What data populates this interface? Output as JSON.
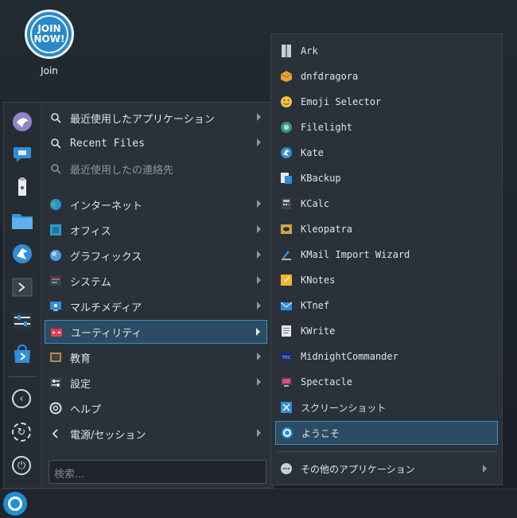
{
  "desktop": {
    "icon_label": "Join",
    "logo_line1": "JOIN",
    "logo_line2": "NOW!"
  },
  "menu": {
    "categories": [
      {
        "label": "最近使用したアプリケーション",
        "icon": "search-icon"
      },
      {
        "label": "Recent Files",
        "icon": "search-icon"
      },
      {
        "label": "最近使用したの連絡先",
        "icon": "search-icon"
      },
      {
        "label": "インターネット",
        "icon": "globe-icon"
      },
      {
        "label": "オフィス",
        "icon": "office-icon"
      },
      {
        "label": "グラフィックス",
        "icon": "graphics-icon"
      },
      {
        "label": "システム",
        "icon": "system-icon"
      },
      {
        "label": "マルチメディア",
        "icon": "multimedia-icon"
      },
      {
        "label": "ユーティリティ",
        "icon": "utilities-icon"
      },
      {
        "label": "教育",
        "icon": "education-icon"
      },
      {
        "label": "設定",
        "icon": "settings-icon"
      },
      {
        "label": "ヘルプ",
        "icon": "help-icon"
      },
      {
        "label": "電源/セッション",
        "icon": "chevron-left-icon"
      }
    ],
    "selected_category": "ユーティリティ",
    "search_placeholder": "検索..."
  },
  "submenu": {
    "apps": [
      {
        "label": "Ark",
        "icon": "ark-icon"
      },
      {
        "label": "dnfdragora",
        "icon": "dnfdragora-icon"
      },
      {
        "label": "Emoji Selector",
        "icon": "emoji-icon"
      },
      {
        "label": "Filelight",
        "icon": "filelight-icon"
      },
      {
        "label": "Kate",
        "icon": "kate-icon"
      },
      {
        "label": "KBackup",
        "icon": "kbackup-icon"
      },
      {
        "label": "KCalc",
        "icon": "kcalc-icon"
      },
      {
        "label": "Kleopatra",
        "icon": "kleopatra-icon"
      },
      {
        "label": "KMail Import Wizard",
        "icon": "kmail-icon"
      },
      {
        "label": "KNotes",
        "icon": "knotes-icon"
      },
      {
        "label": "KTnef",
        "icon": "ktnef-icon"
      },
      {
        "label": "KWrite",
        "icon": "kwrite-icon"
      },
      {
        "label": "MidnightCommander",
        "icon": "mc-icon"
      },
      {
        "label": "Spectacle",
        "icon": "spectacle-icon"
      },
      {
        "label": "スクリーンショット",
        "icon": "screenshot-icon"
      },
      {
        "label": "ようこそ",
        "icon": "welcome-icon"
      }
    ],
    "selected_app": "ようこそ",
    "more_apps": "その他のアプリケーション"
  },
  "colors": {
    "accent": "#3d8ec4",
    "selection_bg": "#2c4c63",
    "menu_bg": "#2a3138"
  }
}
